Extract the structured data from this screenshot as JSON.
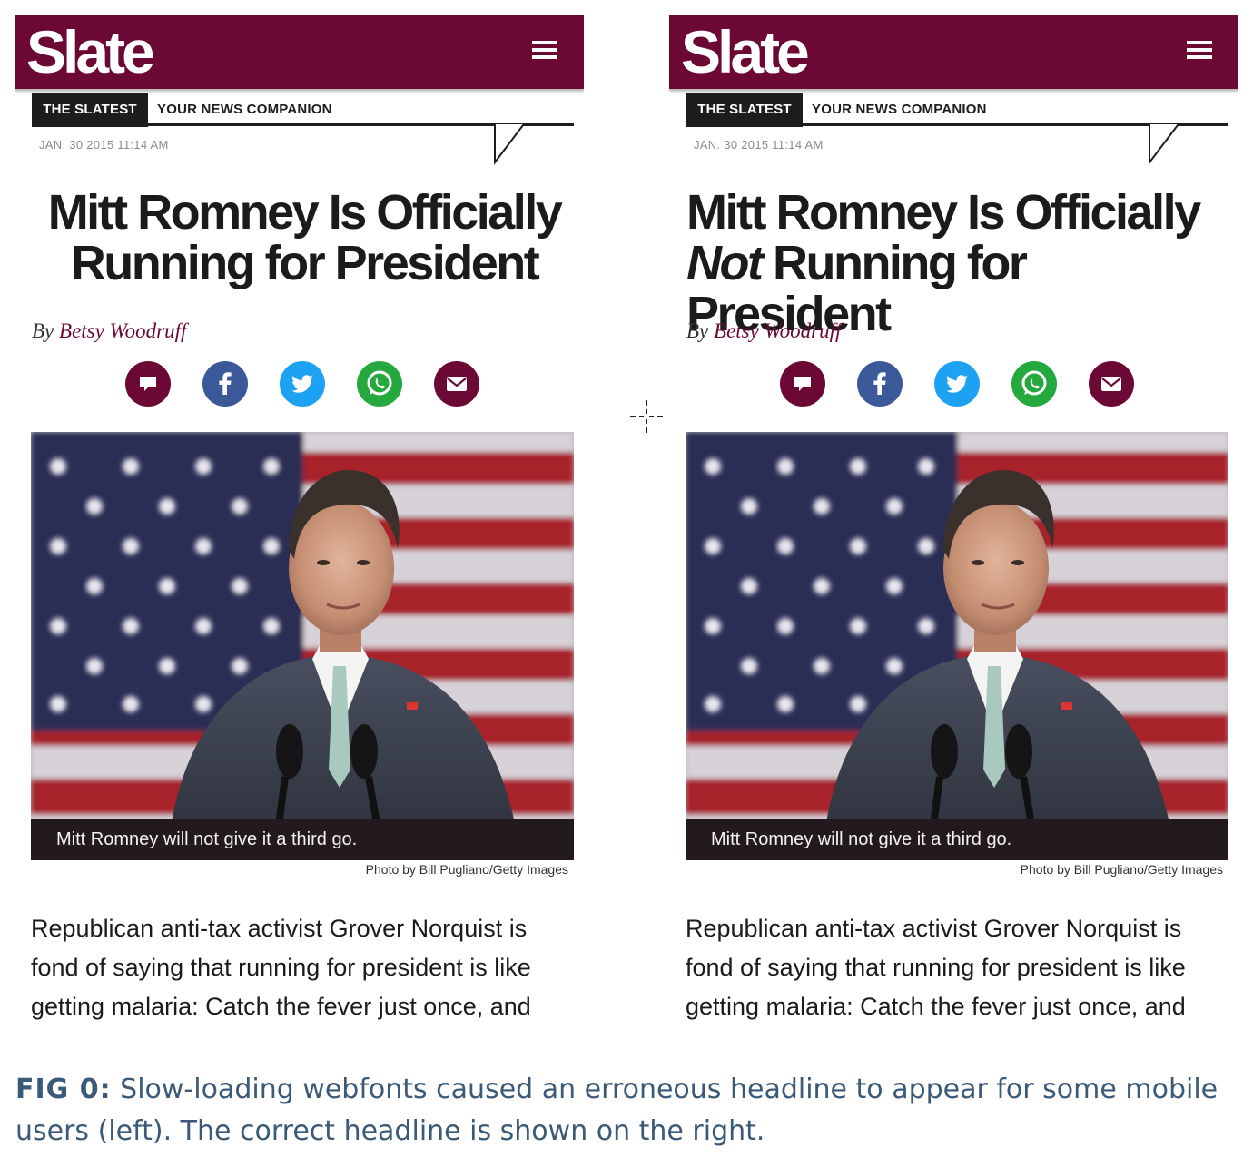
{
  "colors": {
    "brand": "#6b0934",
    "facebook": "#3b5998",
    "twitter": "#1da1f2",
    "whatsapp": "#25a93e",
    "caption_text": "#3a5a78"
  },
  "panels": [
    {
      "logo": "Slate",
      "tag": "THE SLATEST",
      "companion": "YOUR NEWS COMPANION",
      "timestamp": "JAN. 30 2015 11:14 AM",
      "headline_line1": "Mitt Romney Is Officially",
      "headline_emphasis": "",
      "headline_line2": "Running for President",
      "byline_prefix": "By ",
      "author": "Betsy Woodruff",
      "share_icons": [
        "comment-icon",
        "facebook-icon",
        "twitter-icon",
        "whatsapp-icon",
        "email-icon"
      ],
      "photo_caption": "Mitt Romney will not give it a third go.",
      "photo_credit": "Photo by Bill Pugliano/Getty Images",
      "body": "Republican anti-tax activist Grover Norquist is fond of saying that running for president is like getting malaria: Catch the fever just once, and"
    },
    {
      "logo": "Slate",
      "tag": "THE SLATEST",
      "companion": "YOUR NEWS COMPANION",
      "timestamp": "JAN. 30 2015 11:14 AM",
      "headline_line1": "Mitt Romney Is Officially",
      "headline_emphasis": "Not",
      "headline_line2": " Running for President",
      "byline_prefix": "By ",
      "author": "Betsy Woodruff",
      "share_icons": [
        "comment-icon",
        "facebook-icon",
        "twitter-icon",
        "whatsapp-icon",
        "email-icon"
      ],
      "photo_caption": "Mitt Romney will not give it a third go.",
      "photo_credit": "Photo by Bill Pugliano/Getty Images",
      "body": "Republican anti-tax activist Grover Norquist is fond of saying that running for president is like getting malaria: Catch the fever just once, and"
    }
  ],
  "figure": {
    "label": "FIG 0:",
    "text": " Slow-loading webfonts caused an erroneous headline to appear for some mobile users (left). The correct headline is shown on the right."
  }
}
